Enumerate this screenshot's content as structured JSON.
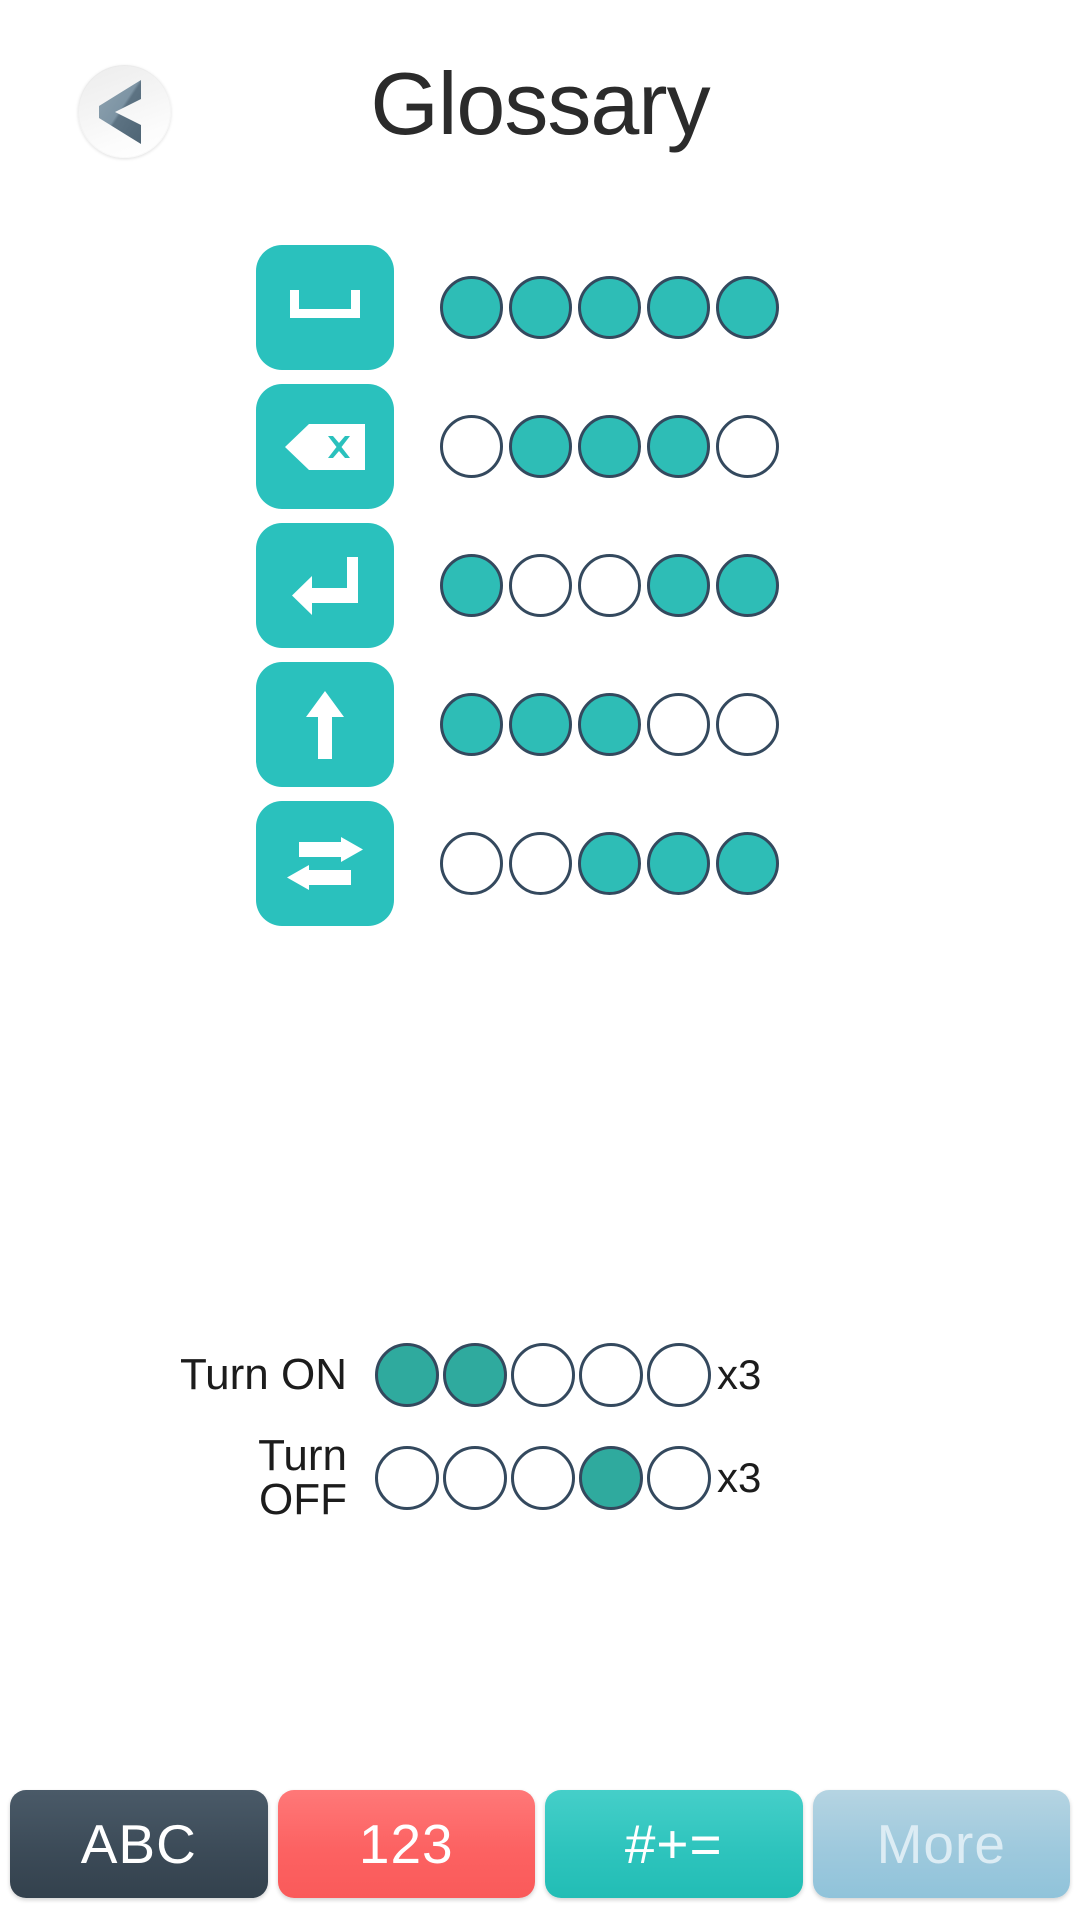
{
  "header": {
    "title": "Glossary",
    "back_icon": "chevron-left-icon"
  },
  "glossary": {
    "rows": [
      {
        "key": "space",
        "icon": "spacebar-icon",
        "label": "Space",
        "pattern": [
          1,
          1,
          1,
          1,
          1
        ]
      },
      {
        "key": "backspace",
        "icon": "backspace-icon",
        "label": "Backspace",
        "pattern": [
          0,
          1,
          1,
          1,
          0
        ]
      },
      {
        "key": "enter",
        "icon": "enter-return-icon",
        "label": "Enter",
        "pattern": [
          1,
          0,
          0,
          1,
          1
        ]
      },
      {
        "key": "shift",
        "icon": "shift-up-arrow-icon",
        "label": "Shift",
        "pattern": [
          1,
          1,
          1,
          0,
          0
        ]
      },
      {
        "key": "tab",
        "icon": "tab-arrows-icon",
        "label": "Tab",
        "pattern": [
          0,
          0,
          1,
          1,
          1
        ]
      }
    ]
  },
  "legend": {
    "rows": [
      {
        "label": "Turn ON",
        "pattern": [
          1,
          1,
          0,
          0,
          0
        ],
        "multiplier": "x3"
      },
      {
        "label": "Turn OFF",
        "pattern": [
          0,
          0,
          0,
          1,
          0
        ],
        "multiplier": "x3"
      }
    ]
  },
  "bottom_bar": {
    "buttons": [
      {
        "label": "ABC",
        "style": "mode-abc"
      },
      {
        "label": "123",
        "style": "mode-123"
      },
      {
        "label": "#+=",
        "style": "mode-sym"
      },
      {
        "label": "More",
        "style": "mode-more"
      }
    ]
  },
  "colors": {
    "accent_teal": "#2ac1bd",
    "dot_fill": "#2ebdb6",
    "dot_stroke": "#34495e",
    "legend_dot_fill": "#2faa9e",
    "abc": "#3c4b58",
    "numbers": "#fc6262",
    "symbols": "#2ec4bd",
    "more": "#9ec9dd",
    "title": "#2b2b2b",
    "background": "#ffffff"
  }
}
